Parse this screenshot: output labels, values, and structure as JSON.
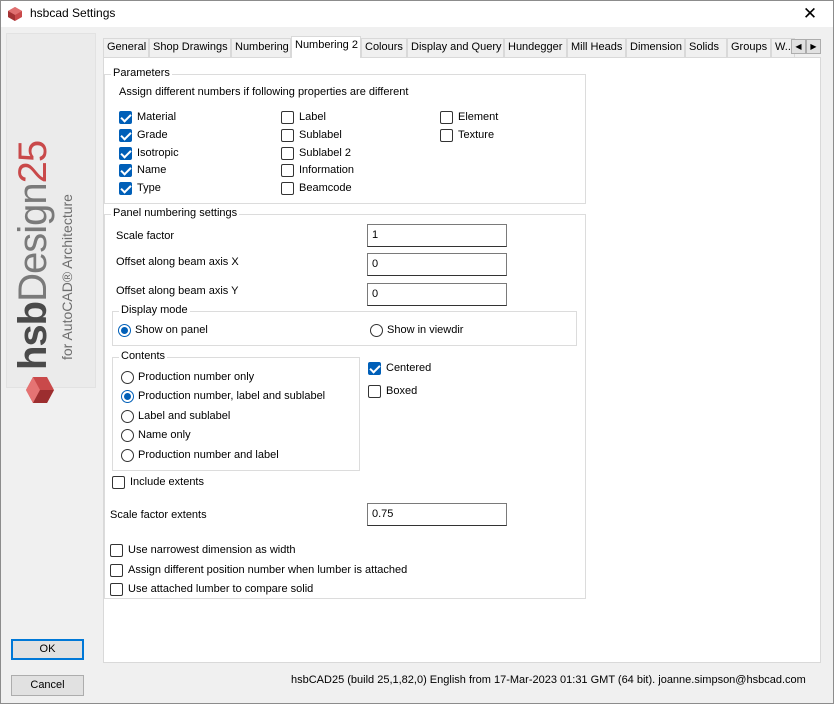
{
  "window": {
    "title": "hsbcad Settings",
    "close_glyph": "✕",
    "title_icon": "hsbcad-logo-icon"
  },
  "brand": {
    "part1": "hsb",
    "part2": "Design",
    "part3": "25",
    "subtitle": "for AutoCAD® Architecture"
  },
  "tabs": [
    {
      "label": "General"
    },
    {
      "label": "Shop Drawings"
    },
    {
      "label": "Numbering"
    },
    {
      "label": "Numbering 2",
      "active": true
    },
    {
      "label": "Colours"
    },
    {
      "label": "Display and Query"
    },
    {
      "label": "Hundegger"
    },
    {
      "label": "Mill Heads"
    },
    {
      "label": "Dimension"
    },
    {
      "label": "Solids"
    },
    {
      "label": "Groups"
    },
    {
      "label": "W..."
    }
  ],
  "tab_scroll": {
    "left": "◀",
    "right": "▶"
  },
  "parameters": {
    "group_label": "Parameters",
    "hint": "Assign different numbers if following properties are different",
    "col1": [
      {
        "label": "Material",
        "checked": true
      },
      {
        "label": "Grade",
        "checked": true
      },
      {
        "label": "Isotropic",
        "checked": true
      },
      {
        "label": "Name",
        "checked": true
      },
      {
        "label": "Type",
        "checked": true
      }
    ],
    "col2": [
      {
        "label": "Label",
        "checked": false
      },
      {
        "label": "Sublabel",
        "checked": false
      },
      {
        "label": "Sublabel 2",
        "checked": false
      },
      {
        "label": "Information",
        "checked": false
      },
      {
        "label": "Beamcode",
        "checked": false
      }
    ],
    "col3": [
      {
        "label": "Element",
        "checked": false
      },
      {
        "label": "Texture",
        "checked": false
      }
    ]
  },
  "panel": {
    "group_label": "Panel numbering settings",
    "scale_factor_label": "Scale factor",
    "scale_factor_value": "1",
    "offset_x_label": "Offset along beam axis X",
    "offset_x_value": "0",
    "offset_y_label": "Offset along beam axis Y",
    "offset_y_value": "0",
    "display_mode": {
      "label": "Display mode",
      "opt1": "Show on panel",
      "opt2": "Show in viewdir",
      "selected": "Show on panel"
    },
    "contents": {
      "label": "Contents",
      "options": [
        {
          "label": "Production number only",
          "selected": false
        },
        {
          "label": "Production number, label and sublabel",
          "selected": true
        },
        {
          "label": "Label and sublabel",
          "selected": false
        },
        {
          "label": "Name only",
          "selected": false
        },
        {
          "label": "Production number and label",
          "selected": false
        }
      ]
    },
    "centered": {
      "label": "Centered",
      "checked": true
    },
    "boxed": {
      "label": "Boxed",
      "checked": false
    },
    "include_extents": {
      "label": "Include extents",
      "checked": false
    },
    "scale_extents_label": "Scale factor extents",
    "scale_extents_value": "0.75",
    "narrowest": {
      "label": "Use narrowest dimension as width",
      "checked": false
    },
    "assign_diff": {
      "label": "Assign different position number when lumber is attached",
      "checked": false
    },
    "attached_lumber": {
      "label": "Use attached lumber to compare solid",
      "checked": false
    }
  },
  "buttons": {
    "ok": "OK",
    "cancel": "Cancel"
  },
  "status": "hsbCAD25 (build 25,1,82,0) English from 17-Mar-2023 01:31 GMT (64 bit). joanne.simpson@hsbcad.com",
  "colors": {
    "accent": "#005fb8",
    "brand_red": "#c9494a"
  }
}
